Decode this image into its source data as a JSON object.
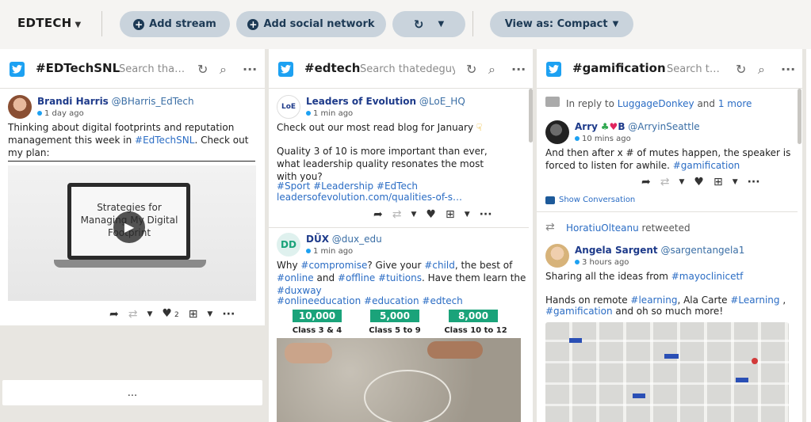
{
  "topbar": {
    "brand": "EDTECH",
    "add_stream": "Add stream",
    "add_social": "Add social network",
    "view_as": "View as: Compact"
  },
  "columns": [
    {
      "title": "#EDTechSNL",
      "search": "Search tha…",
      "tweet": {
        "name": "Brandi Harris",
        "handle": "@BHarris_EdTech",
        "time": "1 day ago",
        "text": "Thinking about digital footprints and reputation management this week in ",
        "tag": "#EdTechSNL",
        "text2": ". Check out my plan:",
        "media_text": "Strategies for Managing My Digital Footprint",
        "likes": "2"
      },
      "more": "..."
    },
    {
      "title": "#edtech",
      "search": "Search thatedeguy",
      "tweet1": {
        "name": "Leaders of Evolution",
        "handle": "@LoE_HQ",
        "time": "1 min ago",
        "line1": "Check out our most read blog for January",
        "line2": "Quality 3 of 10 is more important than ever, what leadership quality resonates the most with you?",
        "tags": "#Sport #Leadership #EdTech",
        "link": "leadersofevolution.com/qualities-of-s…"
      },
      "tweet2": {
        "name": "DŨX",
        "handle": "@dux_edu",
        "time": "1 min ago",
        "t1": "Why ",
        "h1": "#compromise",
        "t2": "? Give your ",
        "h2": "#child",
        "t3": ", the best of ",
        "h3": "#online",
        "t4": " and ",
        "h4": "#offline",
        "t5": " ",
        "h5": "#tuitions",
        "t6": ". Have them learn the ",
        "h6": "#duxway",
        "tags": "#onlineeducation #education #edtech",
        "prices": [
          "10,000",
          "5,000",
          "8,000"
        ],
        "classes": [
          "Class 3 & 4",
          "Class 5 to 9",
          "Class 10 to 12"
        ]
      }
    },
    {
      "title": "#gamification",
      "search": "Search t…",
      "reply": {
        "prefix": "In reply to ",
        "user": "LuggageDonkey",
        "mid": " and ",
        "more": "1 more"
      },
      "tweet1": {
        "name": "Arry",
        "name_suffix": "B",
        "handle": "@ArryinSeattle",
        "time": "10 mins ago",
        "text": "And then after x # of mutes happen, the speaker is forced to listen for awhile. ",
        "tag": "#gamification",
        "show_conversation": "Show Conversation"
      },
      "retweet": {
        "user": "HoratiuOlteanu",
        "label": " retweeted"
      },
      "tweet2": {
        "name": "Angela Sargent",
        "handle": "@sargentangela1",
        "time": "3 hours ago",
        "line1a": "Sharing all the ideas from ",
        "line1b": "#mayoclinicetf",
        "line2a": "Hands on remote ",
        "line2b": "#learning",
        "line2c": ", Ala Carte ",
        "line2d": "#Learning",
        "line2e": " ,",
        "line3a": "#gamification",
        "line3b": " and oh so much more!"
      }
    }
  ],
  "colors": {
    "twitter": "#1da1f2",
    "pill_bg": "#c9d3dc",
    "pill_text": "#1d3a55",
    "link": "#2a6cc4",
    "green_price": "#1aa37a"
  }
}
